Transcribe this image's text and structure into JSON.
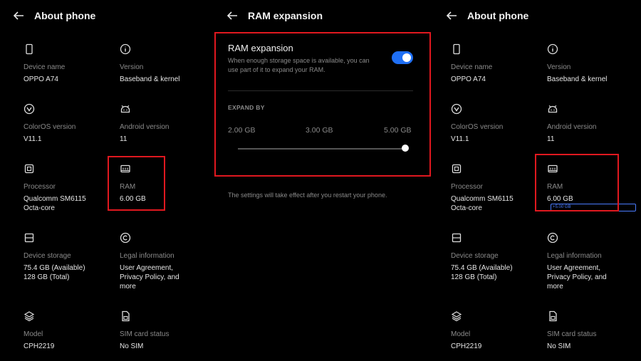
{
  "left": {
    "title": "About phone",
    "items": [
      {
        "icon": "phone-icon",
        "label": "Device name",
        "value": [
          "OPPO A74"
        ]
      },
      {
        "icon": "info-icon",
        "label": "Version",
        "value": [
          "Baseband & kernel"
        ]
      },
      {
        "icon": "coloros-icon",
        "label": "ColorOS version",
        "value": [
          "V11.1"
        ]
      },
      {
        "icon": "android-icon",
        "label": "Android version",
        "value": [
          "11"
        ]
      },
      {
        "icon": "processor-icon",
        "label": "Processor",
        "value": [
          "Qualcomm SM6115",
          "Octa-core"
        ]
      },
      {
        "icon": "ram-icon",
        "label": "RAM",
        "value": [
          "6.00 GB"
        ]
      },
      {
        "icon": "storage-icon",
        "label": "Device storage",
        "value": [
          "75.4 GB (Available)",
          "128 GB (Total)"
        ]
      },
      {
        "icon": "copyright-icon",
        "label": "Legal information",
        "value": [
          "User Agreement,",
          "Privacy Policy, and",
          "more"
        ]
      },
      {
        "icon": "layers-icon",
        "label": "Model",
        "value": [
          "CPH2219"
        ]
      },
      {
        "icon": "sim-icon",
        "label": "SIM card status",
        "value": [
          "No SIM"
        ]
      }
    ]
  },
  "middle": {
    "title": "RAM expansion",
    "card_title": "RAM expansion",
    "card_desc": "When enough storage space is available, you can use part of it to expand your RAM.",
    "toggle_on": true,
    "expand_label": "EXPAND BY",
    "options": [
      "2.00 GB",
      "3.00 GB",
      "5.00 GB"
    ],
    "selected_option": "5.00 GB",
    "note": "The settings will take effect after you restart your phone."
  },
  "right": {
    "title": "About phone",
    "ram_badge": "+5.00 GB",
    "items": [
      {
        "icon": "phone-icon",
        "label": "Device name",
        "value": [
          "OPPO A74"
        ]
      },
      {
        "icon": "info-icon",
        "label": "Version",
        "value": [
          "Baseband & kernel"
        ]
      },
      {
        "icon": "coloros-icon",
        "label": "ColorOS version",
        "value": [
          "V11.1"
        ]
      },
      {
        "icon": "android-icon",
        "label": "Android version",
        "value": [
          "11"
        ]
      },
      {
        "icon": "processor-icon",
        "label": "Processor",
        "value": [
          "Qualcomm SM6115",
          "Octa-core"
        ]
      },
      {
        "icon": "ram-icon",
        "label": "RAM",
        "value": [
          "6.00 GB"
        ]
      },
      {
        "icon": "storage-icon",
        "label": "Device storage",
        "value": [
          "75.4 GB (Available)",
          "128 GB (Total)"
        ]
      },
      {
        "icon": "copyright-icon",
        "label": "Legal information",
        "value": [
          "User Agreement,",
          "Privacy Policy, and",
          "more"
        ]
      },
      {
        "icon": "layers-icon",
        "label": "Model",
        "value": [
          "CPH2219"
        ]
      },
      {
        "icon": "sim-icon",
        "label": "SIM card status",
        "value": [
          "No SIM"
        ]
      }
    ]
  },
  "colors": {
    "highlight": "#e0181f",
    "accent": "#1f6ff5",
    "background": "#000000"
  }
}
